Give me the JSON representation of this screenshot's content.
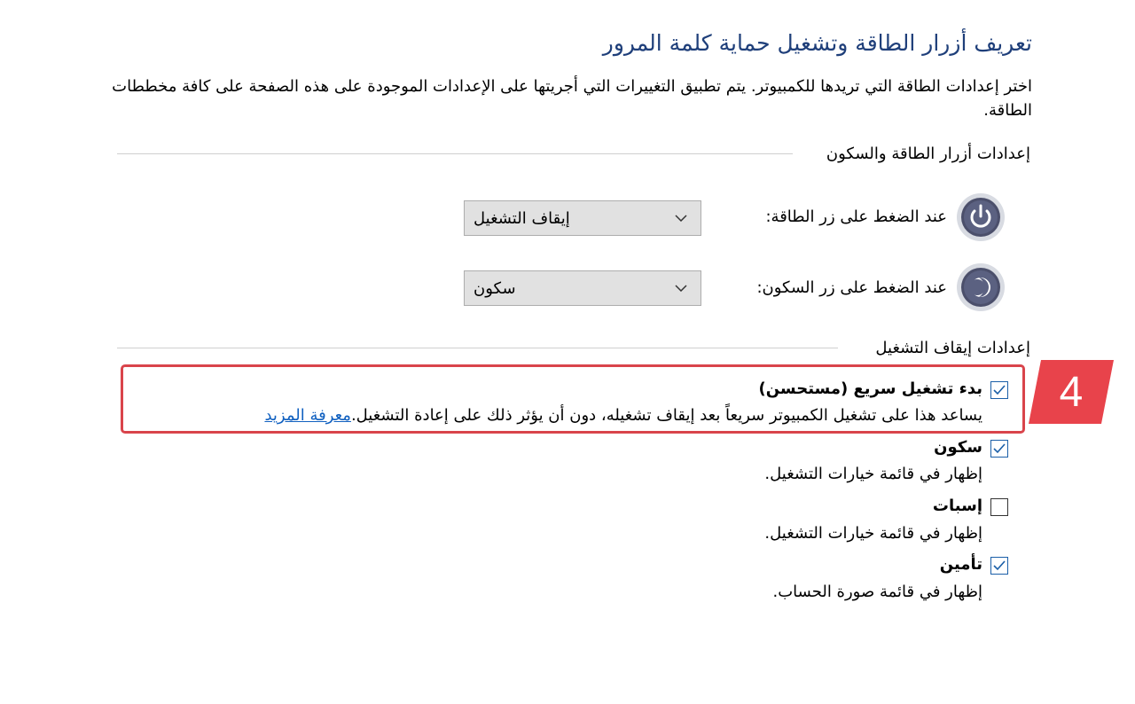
{
  "page": {
    "title": "تعريف أزرار الطاقة وتشغيل حماية كلمة المرور",
    "description": "اختر إعدادات الطاقة التي تريدها للكمبيوتر. يتم تطبيق التغييرات التي أجريتها على الإعدادات الموجودة على هذه الصفحة على كافة مخططات الطاقة."
  },
  "power_buttons_section": {
    "heading": "إعدادات أزرار الطاقة والسكون",
    "power_button": {
      "label": "عند الضغط على زر الطاقة:",
      "value": "إيقاف التشغيل",
      "icon": "power-icon"
    },
    "sleep_button": {
      "label": "عند الضغط على زر السكون:",
      "value": "سكون",
      "icon": "sleep-icon"
    }
  },
  "shutdown_section": {
    "heading": "إعدادات إيقاف التشغيل",
    "options": [
      {
        "title": "بدء تشغيل سريع (مستحسن)",
        "description": "يساعد هذا على تشغيل الكمبيوتر سريعاً بعد إيقاف تشغيله، دون أن يؤثر ذلك على إعادة التشغيل.",
        "link": "معرفة المزيد",
        "checked": true
      },
      {
        "title": "سكون",
        "description": "إظهار في قائمة خيارات التشغيل.",
        "checked": true
      },
      {
        "title": "إسبات",
        "description": "إظهار في قائمة خيارات التشغيل.",
        "checked": false
      },
      {
        "title": "تأمين",
        "description": "إظهار في قائمة صورة الحساب.",
        "checked": true
      }
    ]
  },
  "annotation": {
    "step_number": "4",
    "color": "#e8434b"
  },
  "colors": {
    "title": "#1f3f7a",
    "link": "#1060c0",
    "highlight": "#d9444b"
  }
}
